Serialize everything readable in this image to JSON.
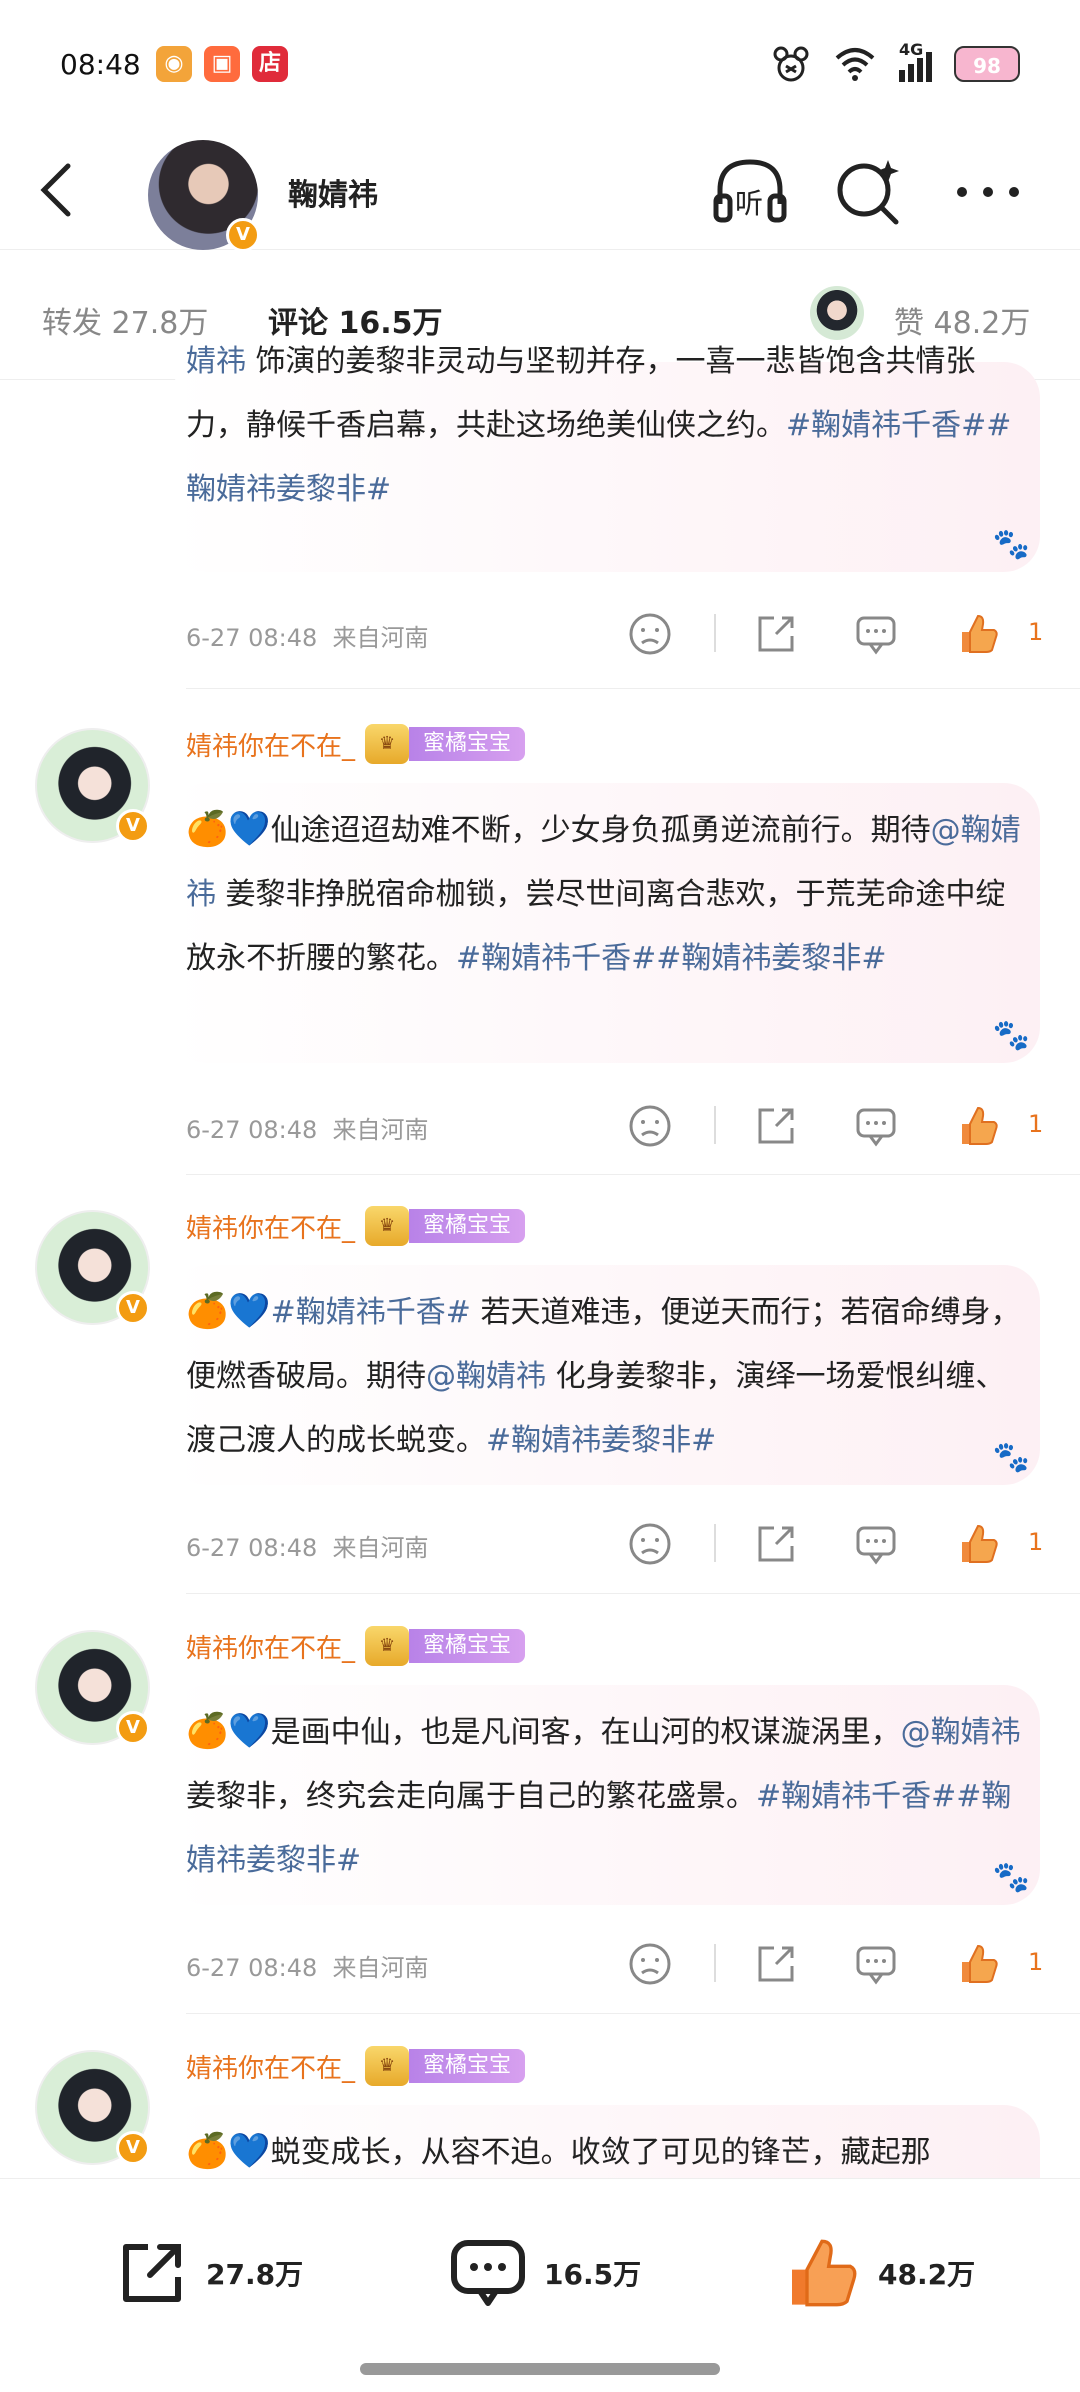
{
  "status_bar": {
    "time": "08:48",
    "apps": [
      {
        "icon": "weibo-app-icon",
        "color": "#f3a43a"
      },
      {
        "icon": "camera-app-icon",
        "color": "#ff6b3d"
      },
      {
        "icon": "shop-app-icon",
        "color": "#e02b3a",
        "label": "店"
      }
    ],
    "network": "4G",
    "battery": "98"
  },
  "header": {
    "username": "鞠婧祎",
    "verified_badge": "V",
    "listen_label": "听"
  },
  "tabs": [
    {
      "label": "转发",
      "count": "27.8万"
    },
    {
      "label": "评论",
      "count": "16.5万"
    },
    {
      "label": "赞",
      "count": "48.2万"
    }
  ],
  "comments": [
    {
      "partial": true,
      "text_parts": [
        {
          "t": "婧祎",
          "link": true
        },
        {
          "t": " 饰演的姜黎非灵动与坚韧并存，一喜一悲皆饱含共情张力，静候千香启幕，共赴这场绝美仙侠之约。",
          "link": false
        },
        {
          "t": "#鞠婧祎千香##鞠婧祎姜黎非#",
          "link": true
        }
      ],
      "time": "6-27 08:48",
      "location": "来自河南",
      "likes": "1"
    },
    {
      "name": "婧祎你在不在_",
      "medal": "蜜橘宝宝",
      "text_parts": [
        {
          "t": "🍊💙",
          "emoji": true
        },
        {
          "t": "仙途迢迢劫难不断，少女身负孤勇逆流前行。期待",
          "link": false
        },
        {
          "t": "@鞠婧祎",
          "link": true
        },
        {
          "t": " 姜黎非挣脱宿命枷锁，尝尽世间离合悲欢，于荒芜命途中绽放永不折腰的繁花。",
          "link": false
        },
        {
          "t": "#鞠婧祎千香##鞠婧祎姜黎非#",
          "link": true
        }
      ],
      "time": "6-27 08:48",
      "location": "来自河南",
      "likes": "1"
    },
    {
      "name": "婧祎你在不在_",
      "medal": "蜜橘宝宝",
      "text_parts": [
        {
          "t": "🍊💙",
          "emoji": true
        },
        {
          "t": "#鞠婧祎千香#",
          "link": true
        },
        {
          "t": " 若天道难违，便逆天而行；若宿命缚身，便燃香破局。期待",
          "link": false
        },
        {
          "t": "@鞠婧祎",
          "link": true
        },
        {
          "t": " 化身姜黎非，演绎一场爱恨纠缠、渡己渡人的成长蜕变。",
          "link": false
        },
        {
          "t": "#鞠婧祎姜黎非#",
          "link": true
        }
      ],
      "time": "6-27 08:48",
      "location": "来自河南",
      "likes": "1"
    },
    {
      "name": "婧祎你在不在_",
      "medal": "蜜橘宝宝",
      "text_parts": [
        {
          "t": "🍊💙",
          "emoji": true
        },
        {
          "t": "是画中仙，也是凡间客，在山河的权谋漩涡里，",
          "link": false
        },
        {
          "t": "@鞠婧祎",
          "link": true
        },
        {
          "t": " 姜黎非，终究会走向属于自己的繁花盛景。",
          "link": false
        },
        {
          "t": "#鞠婧祎千香##鞠婧祎姜黎非#",
          "link": true
        }
      ],
      "time": "6-27 08:48",
      "location": "来自河南",
      "likes": "1"
    },
    {
      "name": "婧祎你在不在_",
      "medal": "蜜橘宝宝",
      "text_parts": [
        {
          "t": "🍊💙",
          "emoji": true
        },
        {
          "t": "蜕变成长，从容不迫。收敛了可见的锋芒，藏起那",
          "link": false
        }
      ]
    }
  ],
  "bottom_bar": {
    "repost_count": "27.8万",
    "comment_count": "16.5万",
    "like_count": "48.2万"
  },
  "colors": {
    "accent_orange": "#e8731d",
    "tab_underline": "#f5a623",
    "link_blue": "#4a6b9a",
    "medal_purple": "#b882e8"
  }
}
